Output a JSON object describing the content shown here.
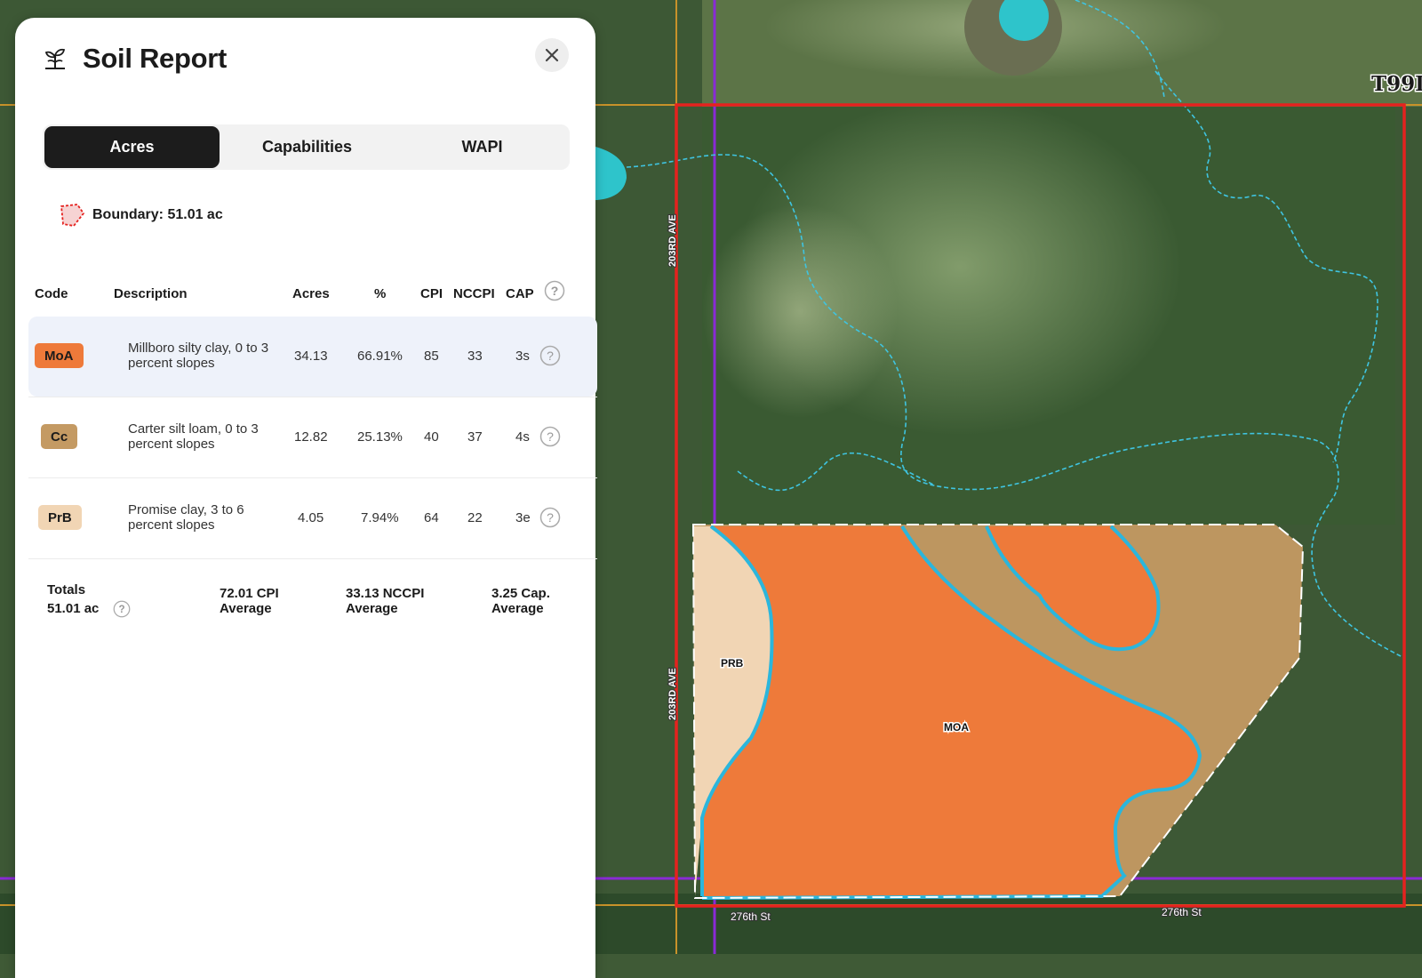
{
  "colors": {
    "moa": "#ee7a3a",
    "cc": "#c49a63",
    "prb": "#f1d5b4",
    "boundary_red": "#e5221f",
    "soil_line": "#2bb6dc"
  },
  "map": {
    "township_label": "T99I",
    "road_west_top": "203RD AVE",
    "road_west_bottom": "203RD AVE",
    "road_south_left": "276th St",
    "road_south_right": "276th St",
    "soil_label_prb": "PRB",
    "soil_label_moa": "MOA"
  },
  "panel": {
    "icon": "plant-sprout-icon",
    "title": "Soil Report",
    "close_icon": "close-icon",
    "tabs": [
      {
        "label": "Acres",
        "active": true
      },
      {
        "label": "Capabilities",
        "active": false
      },
      {
        "label": "WAPI",
        "active": false
      }
    ],
    "boundary": {
      "icon": "boundary-polygon-icon",
      "label": "Boundary: 51.01 ac"
    },
    "columns": {
      "code": "Code",
      "description": "Description",
      "acres": "Acres",
      "percent": "%",
      "cpi": "CPI",
      "nccpi": "NCCPI",
      "cap": "CAP"
    },
    "rows": [
      {
        "code": "MoA",
        "description": "Millboro silty clay, 0 to 3 percent slopes",
        "acres": "34.13",
        "percent": "66.91%",
        "cpi": "85",
        "nccpi": "33",
        "cap": "3s"
      },
      {
        "code": "Cc",
        "description": "Carter silt loam, 0 to 3 percent slopes",
        "acres": "12.82",
        "percent": "25.13%",
        "cpi": "40",
        "nccpi": "37",
        "cap": "4s"
      },
      {
        "code": "PrB",
        "description": "Promise clay, 3 to 6 percent slopes",
        "acres": "4.05",
        "percent": "7.94%",
        "cpi": "64",
        "nccpi": "22",
        "cap": "3e"
      }
    ],
    "totals": {
      "label": "Totals",
      "acres": "51.01 ac",
      "cpi_value": "72.01 CPI",
      "cpi_unit": "Average",
      "nccpi_value": "33.13 NCCPI",
      "nccpi_unit": "Average",
      "cap_value": "3.25 Cap.",
      "cap_unit": "Average"
    }
  }
}
